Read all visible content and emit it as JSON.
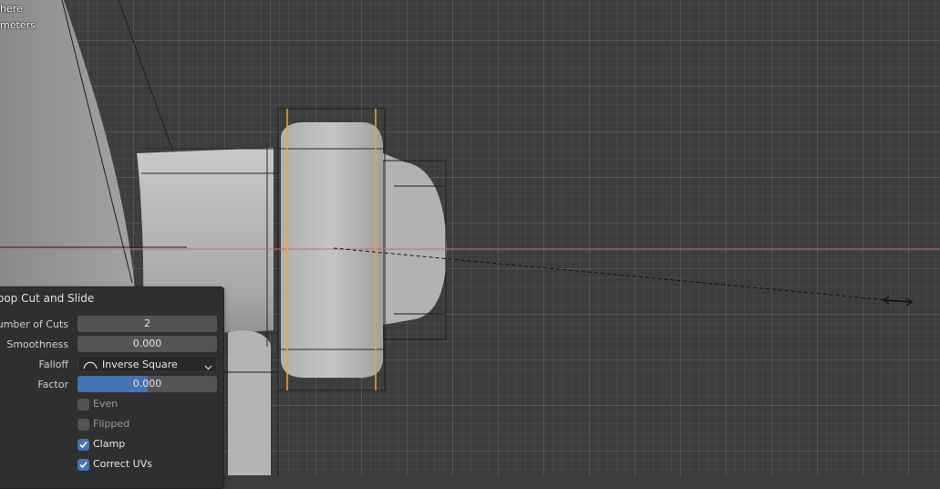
{
  "overlay": {
    "line1": "here",
    "line2": "meters"
  },
  "operator_panel": {
    "title": "oop Cut and Slide",
    "number_of_cuts_label": "Number of Cuts",
    "number_of_cuts_value": "2",
    "smoothness_label": "Smoothness",
    "smoothness_value": "0.000",
    "falloff_label": "Falloff",
    "falloff_value": "Inverse Square",
    "falloff_icon": "inverse-square-curve-icon",
    "factor_label": "Factor",
    "factor_value": "0.000",
    "factor_slider_fill": 0.5,
    "even_label": "Even",
    "even_checked": false,
    "flipped_label": "Flipped",
    "flipped_checked": false,
    "clamp_label": "Clamp",
    "clamp_checked": true,
    "correct_uvs_label": "Correct UVs",
    "correct_uvs_checked": true
  },
  "colors": {
    "viewport_bg": "#3d3d3d",
    "accent_blue": "#4772b3",
    "edge_loop_orange": "#f5a623",
    "x_axis_red": "#e06070"
  }
}
